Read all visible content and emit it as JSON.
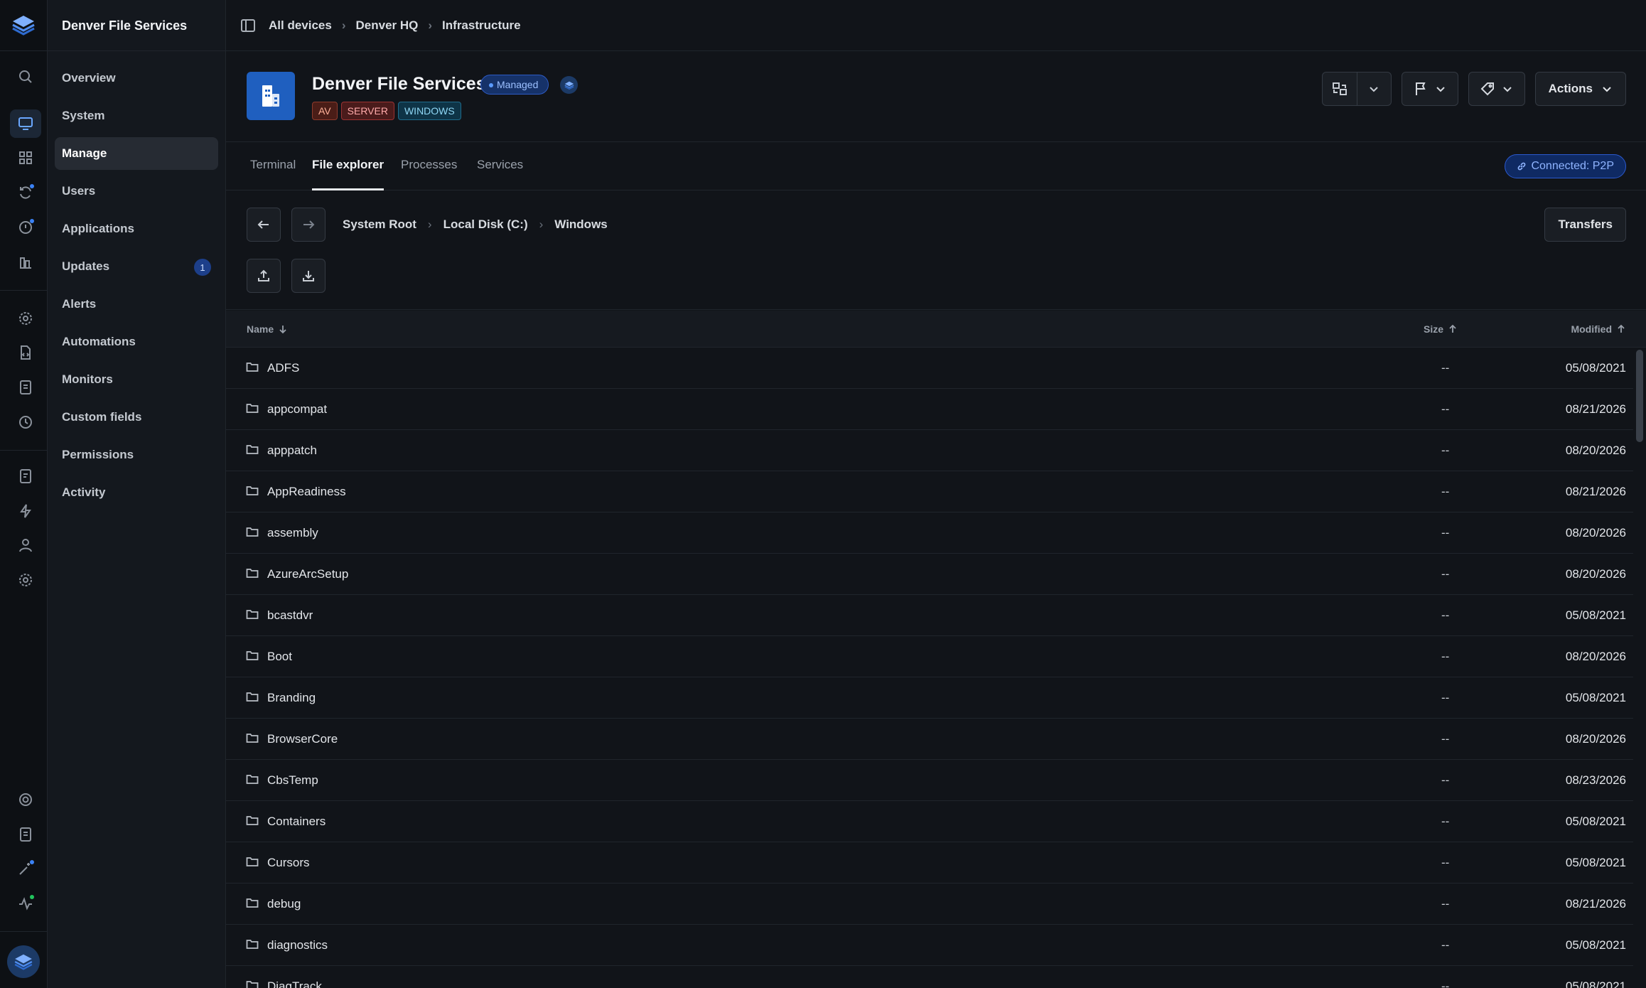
{
  "app": {
    "title": "Denver File Services"
  },
  "breadcrumb": [
    "All devices",
    "Denver HQ",
    "Infrastructure"
  ],
  "sidebar": {
    "items": [
      {
        "label": "Overview"
      },
      {
        "label": "System"
      },
      {
        "label": "Manage",
        "active": true
      },
      {
        "label": "Users"
      },
      {
        "label": "Applications"
      },
      {
        "label": "Updates",
        "badge": "1"
      },
      {
        "label": "Alerts"
      },
      {
        "label": "Automations"
      },
      {
        "label": "Monitors"
      },
      {
        "label": "Custom fields"
      },
      {
        "label": "Permissions"
      },
      {
        "label": "Activity"
      }
    ]
  },
  "device": {
    "name": "Denver File Services",
    "status": "Managed",
    "tags": [
      "AV",
      "SERVER",
      "WINDOWS"
    ],
    "actions_label": "Actions"
  },
  "tabs": [
    "Terminal",
    "File explorer",
    "Processes",
    "Services"
  ],
  "connection": "Connected: P2P",
  "path": [
    "System Root",
    "Local Disk (C:)",
    "Windows"
  ],
  "transfers_label": "Transfers",
  "table": {
    "headers": {
      "name": "Name",
      "size": "Size",
      "modified": "Modified"
    },
    "rows": [
      {
        "name": "ADFS",
        "size": "--",
        "modified": "05/08/2021"
      },
      {
        "name": "appcompat",
        "size": "--",
        "modified": "08/21/2026"
      },
      {
        "name": "apppatch",
        "size": "--",
        "modified": "08/20/2026"
      },
      {
        "name": "AppReadiness",
        "size": "--",
        "modified": "08/21/2026"
      },
      {
        "name": "assembly",
        "size": "--",
        "modified": "08/20/2026"
      },
      {
        "name": "AzureArcSetup",
        "size": "--",
        "modified": "08/20/2026"
      },
      {
        "name": "bcastdvr",
        "size": "--",
        "modified": "05/08/2021"
      },
      {
        "name": "Boot",
        "size": "--",
        "modified": "08/20/2026"
      },
      {
        "name": "Branding",
        "size": "--",
        "modified": "05/08/2021"
      },
      {
        "name": "BrowserCore",
        "size": "--",
        "modified": "08/20/2026"
      },
      {
        "name": "CbsTemp",
        "size": "--",
        "modified": "08/23/2026"
      },
      {
        "name": "Containers",
        "size": "--",
        "modified": "05/08/2021"
      },
      {
        "name": "Cursors",
        "size": "--",
        "modified": "05/08/2021"
      },
      {
        "name": "debug",
        "size": "--",
        "modified": "08/21/2026"
      },
      {
        "name": "diagnostics",
        "size": "--",
        "modified": "05/08/2021"
      },
      {
        "name": "DiagTrack",
        "size": "--",
        "modified": "05/08/2021"
      }
    ]
  },
  "colors": {
    "accent": "#3b82f6",
    "background": "#111419",
    "managed": "#163269"
  }
}
